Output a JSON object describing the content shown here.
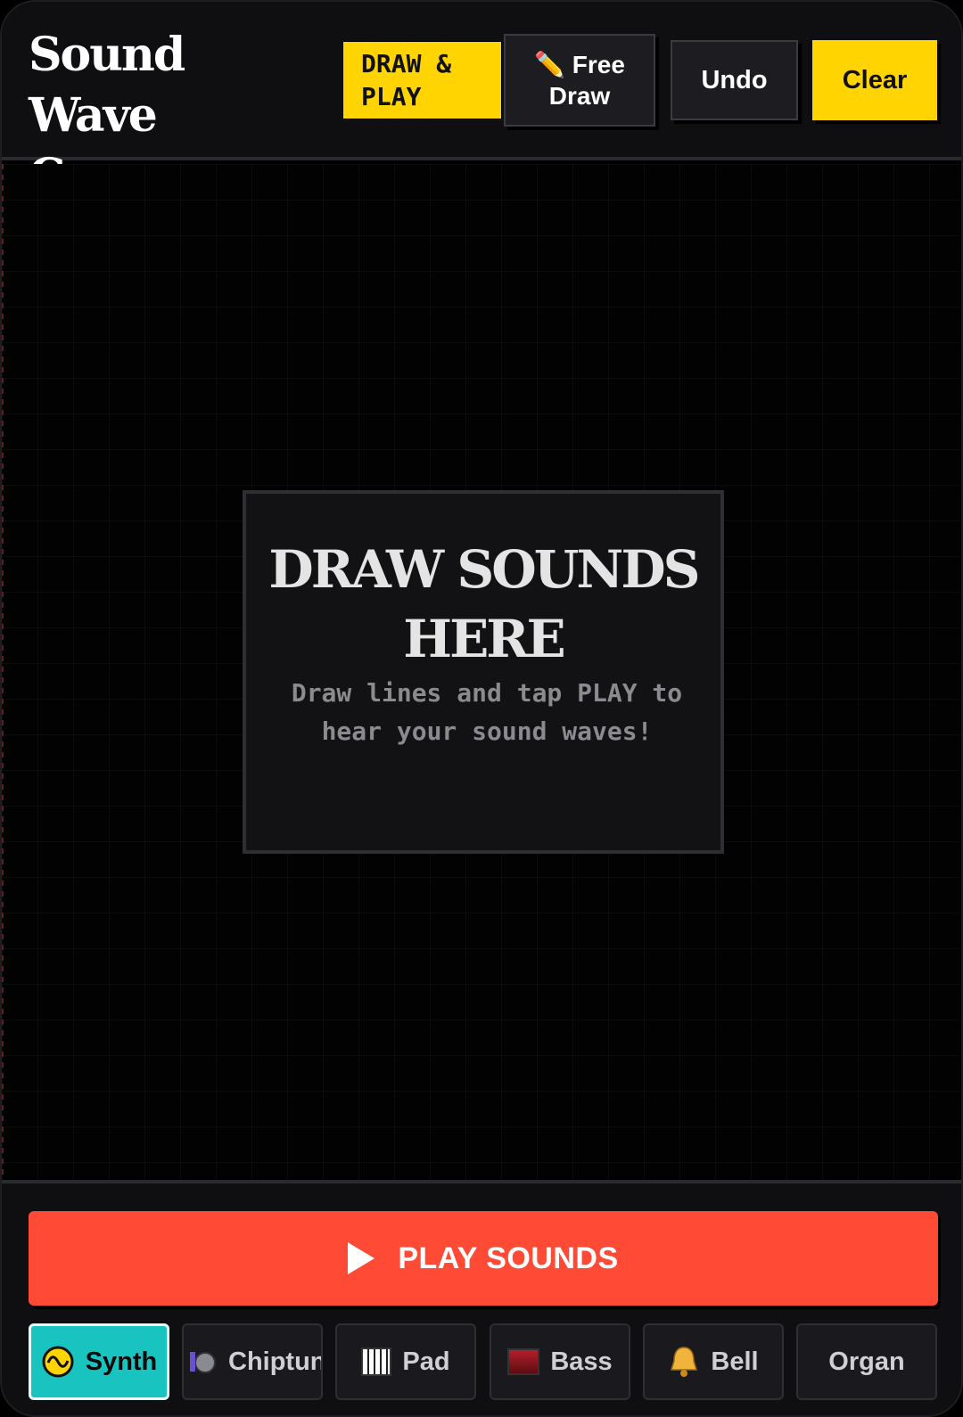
{
  "app": {
    "title": "Sound Wave Canvas"
  },
  "toolbar": {
    "draw_play_label": "DRAW & PLAY",
    "free_draw_label": "Free Draw",
    "free_draw_icon": "pencil-icon",
    "undo_label": "Undo",
    "clear_label": "Clear"
  },
  "canvas": {
    "hint_title": "DRAW SOUNDS HERE",
    "hint_subtitle": "Draw lines and tap PLAY to hear your sound waves!"
  },
  "player": {
    "play_label": "PLAY SOUNDS",
    "play_icon": "play-icon"
  },
  "instruments": [
    {
      "label": "Synth",
      "icon": "synth-icon",
      "active": true
    },
    {
      "label": "Chiptune",
      "icon": "chiptune-icon",
      "active": false
    },
    {
      "label": "Pad",
      "icon": "keyboard-icon",
      "active": false
    },
    {
      "label": "Bass",
      "icon": "bass-icon",
      "active": false
    },
    {
      "label": "Bell",
      "icon": "bell-icon",
      "active": false
    },
    {
      "label": "Organ",
      "icon": "",
      "active": false
    }
  ],
  "colors": {
    "accent_yellow": "#ffd400",
    "play_red": "#ff4a36",
    "active_teal": "#19c4c0",
    "background": "#000000"
  }
}
